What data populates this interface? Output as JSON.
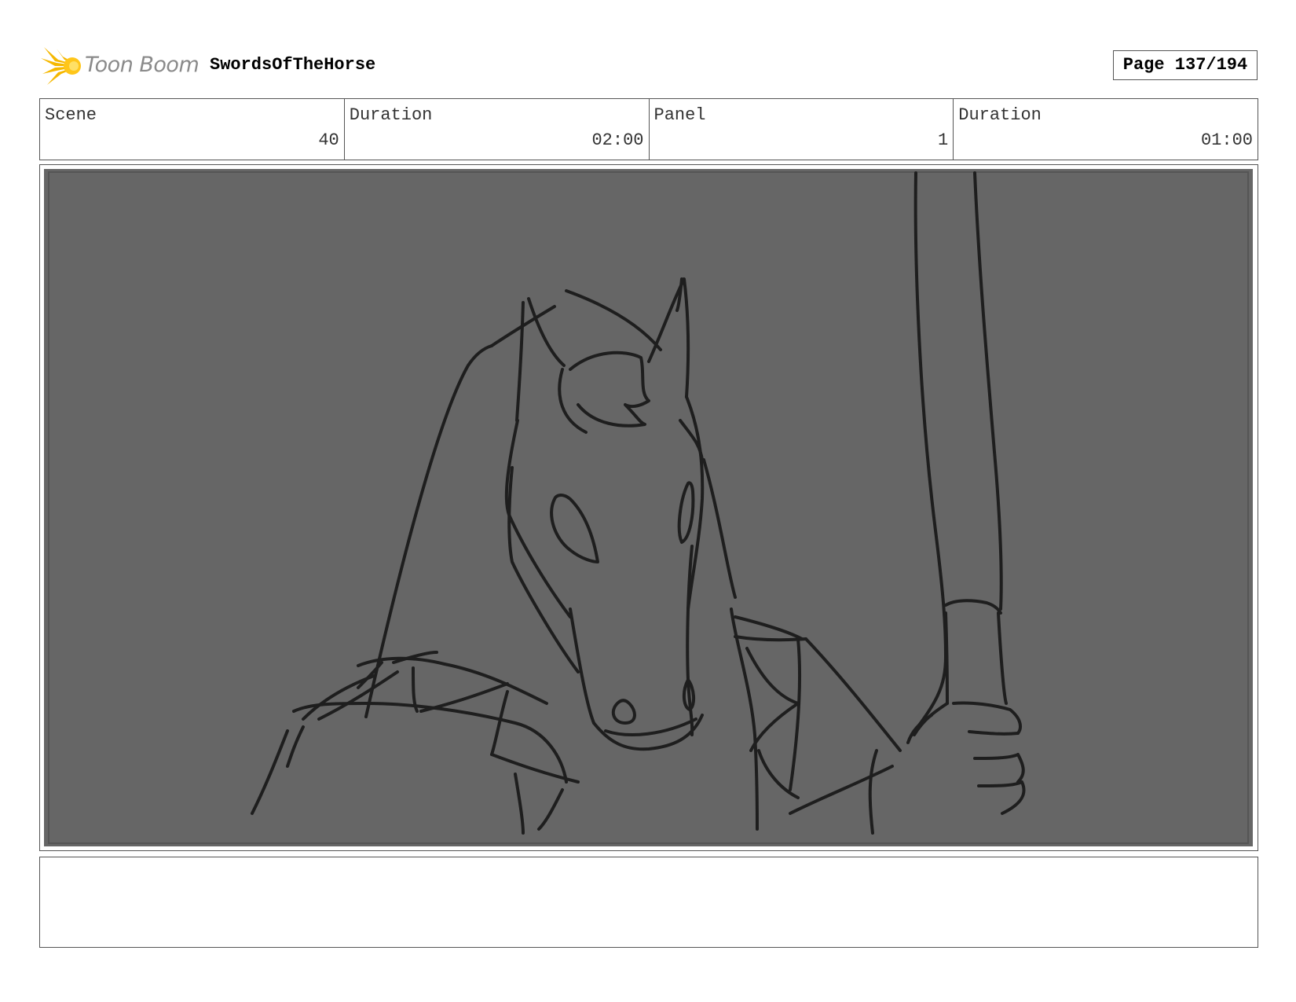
{
  "header": {
    "logo_text": "Toon Boom",
    "project_title": "SwordsOfTheHorse",
    "page_label": "Page 137/194"
  },
  "info": {
    "scene_label": "Scene",
    "scene_value": "40",
    "scene_duration_label": "Duration",
    "scene_duration_value": "02:00",
    "panel_label": "Panel",
    "panel_value": "1",
    "panel_duration_label": "Duration",
    "panel_duration_value": "01:00"
  },
  "panel": {
    "background_color": "#666666",
    "line_color": "#1e1e1e",
    "icon": "horse-sketch"
  },
  "notes": {
    "text": ""
  },
  "colors": {
    "logo_accent": "#f5b800",
    "logo_text": "#8a8a8a",
    "border": "#555555"
  }
}
